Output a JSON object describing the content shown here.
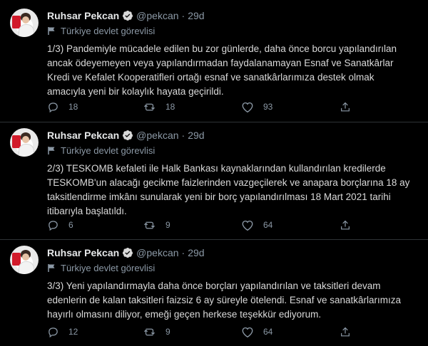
{
  "colors": {
    "background": "#000000",
    "divider": "#2f3336",
    "verified": "#d9d9d9",
    "muted": "#8b98a5",
    "text": "#d9d9d9"
  },
  "tweets": [
    {
      "author": "Ruhsar Pekcan",
      "handle": "@pekcan",
      "separator": "·",
      "time": "29d",
      "label": "Türkiye devlet görevlisi",
      "text": "1/3) Pandemiyle mücadele edilen bu zor günlerde, daha önce borcu yapılandırılan\nancak ödeyemeyen veya yapılandırmadan faydalanamayan Esnaf ve Sanatkârlar\nKredi ve Kefalet Kooperatifleri ortağı esnaf ve sanatkârlarımıza destek olmak\namacıyla yeni bir kolaylık hayata geçirildi.",
      "replies": "18",
      "retweets": "18",
      "likes": "93"
    },
    {
      "author": "Ruhsar Pekcan",
      "handle": "@pekcan",
      "separator": "·",
      "time": "29d",
      "label": "Türkiye devlet görevlisi",
      "text": "2/3) TESKOMB kefaleti ile Halk Bankası kaynaklarından kullandırılan kredilerde\nTESKOMB'un alacağı gecikme faizlerinden vazgeçilerek ve anapara borçlarına 18 ay\ntaksitlendirme imkânı sunularak yeni bir borç yapılandırılması 18 Mart 2021 tarihi\nitibarıyla başlatıldı.",
      "replies": "6",
      "retweets": "9",
      "likes": "64"
    },
    {
      "author": "Ruhsar Pekcan",
      "handle": "@pekcan",
      "separator": "·",
      "time": "29d",
      "label": "Türkiye devlet görevlisi",
      "text": "3/3) Yeni yapılandırmayla daha önce borçları yapılandırılan ve taksitleri devam\nedenlerin de kalan taksitleri faizsiz 6 ay süreyle ötelendi. Esnaf ve sanatkârlarımıza\nhayırlı olmasını diliyor, emeği geçen herkese teşekkür ediyorum.",
      "replies": "12",
      "retweets": "9",
      "likes": "64"
    }
  ]
}
